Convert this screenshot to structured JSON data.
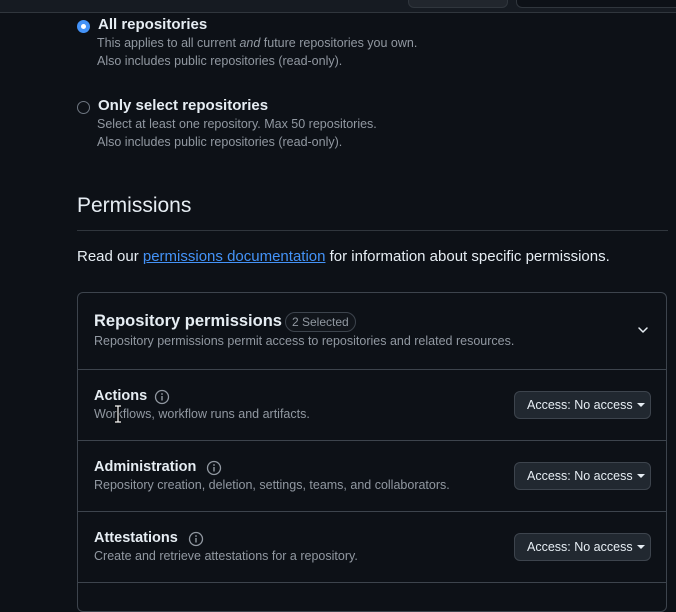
{
  "repo_access": {
    "all": {
      "title": "All repositories",
      "desc_line1_prefix": "This applies to all current ",
      "desc_line1_em": "and",
      "desc_line1_suffix": " future repositories you own.",
      "desc_line2": "Also includes public repositories (read-only).",
      "checked": true
    },
    "select": {
      "title": "Only select repositories",
      "desc_line1": "Select at least one repository. Max 50 repositories.",
      "desc_line2": "Also includes public repositories (read-only).",
      "checked": false
    }
  },
  "permissions": {
    "heading": "Permissions",
    "intro_prefix": "Read our ",
    "intro_link": "permissions documentation",
    "intro_suffix": " for information about specific permissions.",
    "repository": {
      "title": "Repository permissions",
      "counter": "2 Selected",
      "description": "Repository permissions permit access to repositories and related resources.",
      "rows": [
        {
          "name": "Actions",
          "description": "Workflows, workflow runs and artifacts.",
          "access": "Access: No access"
        },
        {
          "name": "Administration",
          "description": "Repository creation, deletion, settings, teams, and collaborators.",
          "access": "Access: No access"
        },
        {
          "name": "Attestations",
          "description": "Create and retrieve attestations for a repository.",
          "access": "Access: No access"
        }
      ]
    }
  },
  "colors": {
    "background": "#0d1117",
    "accent": "#4493f8",
    "border": "#3d444d",
    "muted_text": "#9198a1"
  },
  "icons": {
    "info": "info-icon",
    "chevron": "chevron-down-icon",
    "caret": "triangle-down-icon",
    "cursor": "text-cursor-icon"
  }
}
